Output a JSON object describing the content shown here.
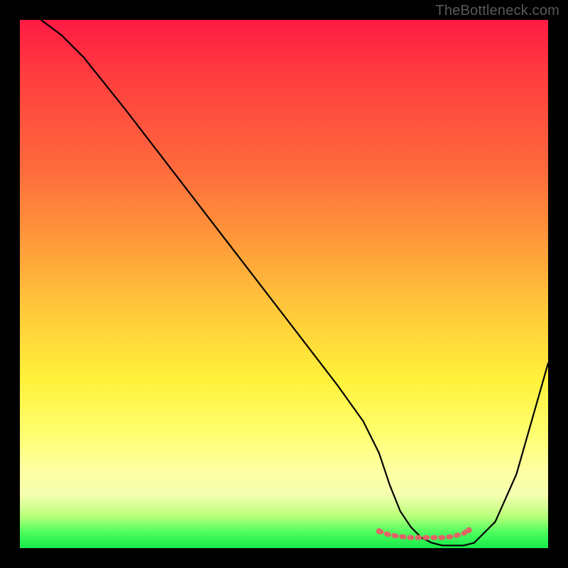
{
  "watermark": "TheBottleneck.com",
  "chart_data": {
    "type": "line",
    "title": "",
    "xlabel": "",
    "ylabel": "",
    "xlim": [
      0,
      100
    ],
    "ylim": [
      0,
      100
    ],
    "series": [
      {
        "name": "bottleneck-curve",
        "x": [
          4,
          8,
          12,
          20,
          30,
          40,
          50,
          60,
          65,
          68,
          70,
          72,
          74,
          76,
          78,
          80,
          82,
          84,
          86,
          90,
          94,
          100
        ],
        "y": [
          100,
          97,
          93,
          83,
          70,
          57,
          44,
          31,
          24,
          18,
          12,
          7,
          4,
          2,
          1,
          0.5,
          0.5,
          0.5,
          1,
          5,
          14,
          35
        ]
      }
    ],
    "highlight_band": {
      "name": "optimal-range",
      "x": [
        68,
        70,
        72,
        74,
        76,
        78,
        80,
        82,
        84,
        85
      ],
      "y": [
        3.2,
        2.5,
        2.2,
        2.0,
        2.0,
        2.0,
        2.0,
        2.2,
        2.8,
        3.4
      ]
    },
    "gradient_stops": [
      {
        "pos": 0,
        "color": "#ff1a44"
      },
      {
        "pos": 28,
        "color": "#ff6a3c"
      },
      {
        "pos": 55,
        "color": "#ffc93a"
      },
      {
        "pos": 78,
        "color": "#ffff6e"
      },
      {
        "pos": 94,
        "color": "#b8ff7a"
      },
      {
        "pos": 100,
        "color": "#17e84a"
      }
    ]
  }
}
